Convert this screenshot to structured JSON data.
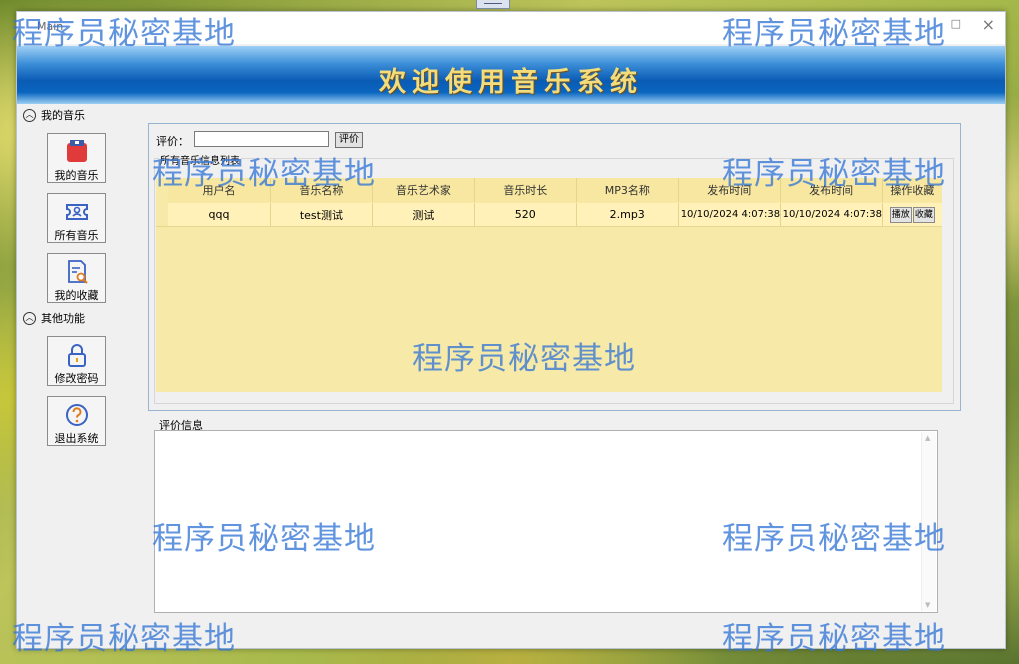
{
  "window": {
    "title": "Main",
    "close_glyph": "×",
    "max_glyph": "□"
  },
  "banner": {
    "title": "欢迎使用音乐系统"
  },
  "sidebar": {
    "section_my": {
      "label": "我的音乐",
      "icon": "chevron-up-icon"
    },
    "section_other": {
      "label": "其他功能",
      "icon": "chevron-up-icon"
    },
    "buttons": [
      {
        "label": "我的音乐",
        "icon": "music-box-icon"
      },
      {
        "label": "所有音乐",
        "icon": "ticket-icon"
      },
      {
        "label": "我的收藏",
        "icon": "document-search-icon"
      },
      {
        "label": "修改密码",
        "icon": "lock-icon"
      },
      {
        "label": "退出系统",
        "icon": "help-icon"
      }
    ]
  },
  "rating": {
    "label": "评价：",
    "button": "评价"
  },
  "music_list": {
    "group_label": "所有音乐信息列表",
    "columns": [
      "用户名",
      "音乐名称",
      "音乐艺术家",
      "音乐时长",
      "MP3名称",
      "发布时间",
      "发布时间",
      "操作收藏"
    ],
    "rows": [
      {
        "cells": [
          "qqq",
          "test测试",
          "测试",
          "520",
          "2.mp3",
          "10/10/2024 4:07:38",
          "10/10/2024 4:07:38"
        ],
        "play": "播放",
        "favorite": "收藏"
      }
    ]
  },
  "review": {
    "label": "评价信息",
    "value": ""
  },
  "watermark": {
    "text": "程序员秘密基地"
  },
  "colors": {
    "banner": "#0a5bb4",
    "banner_text": "#f2dc7c",
    "grid": "#f7eaa9",
    "watermark": "#3476d6"
  }
}
